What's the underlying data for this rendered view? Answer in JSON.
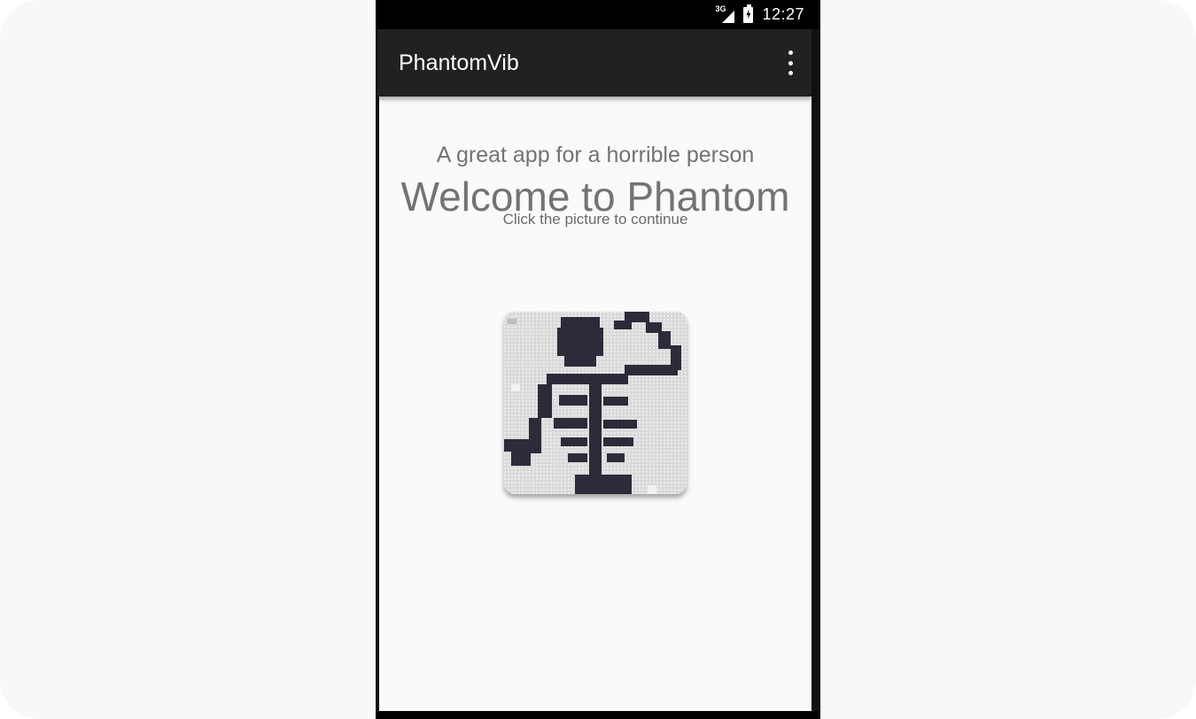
{
  "status_bar": {
    "network_type": "3G",
    "time": "12:27"
  },
  "app_bar": {
    "title": "PhantomVib",
    "menu_icon": "more-vert-icon"
  },
  "main": {
    "tagline": "A great app for a horrible person",
    "welcome": "Welcome to Phantom",
    "hint": "Click the picture to continue",
    "picture_icon": "skeleton-pixel-art"
  },
  "colors": {
    "status_bar": "#000000",
    "app_bar": "#212121",
    "content_background": "#fafafa",
    "text": "#737373",
    "skeleton": "#2b2b3a"
  }
}
